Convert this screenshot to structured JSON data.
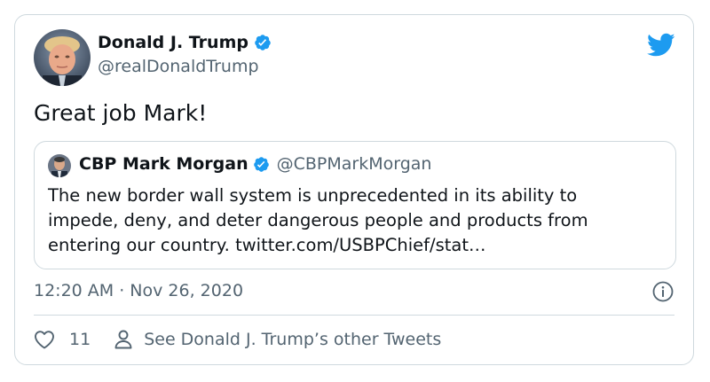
{
  "tweet": {
    "author_name": "Donald J. Trump",
    "author_handle": "@realDonaldTrump",
    "text": "Great job Mark!",
    "timestamp": "12:20 AM · Nov 26, 2020",
    "like_count": "11",
    "other_tweets_link": "See Donald J. Trump’s other Tweets"
  },
  "quote": {
    "author_name": "CBP Mark Morgan",
    "author_handle": "@CBPMarkMorgan",
    "body_lines": [
      "The new border wall system is unprecedented in its ability to",
      "impede, deny, and deter dangerous people and products from",
      "entering our country. twitter.com/USBPChief/stat…"
    ]
  },
  "colors": {
    "twitter_blue": "#1d9bf0",
    "secondary_text": "#536471",
    "border": "#cfd9de"
  },
  "icons": {
    "brand": "twitter-bird-icon",
    "verified": "verified-badge-icon",
    "info": "info-icon",
    "like": "heart-icon",
    "profile": "person-icon"
  }
}
